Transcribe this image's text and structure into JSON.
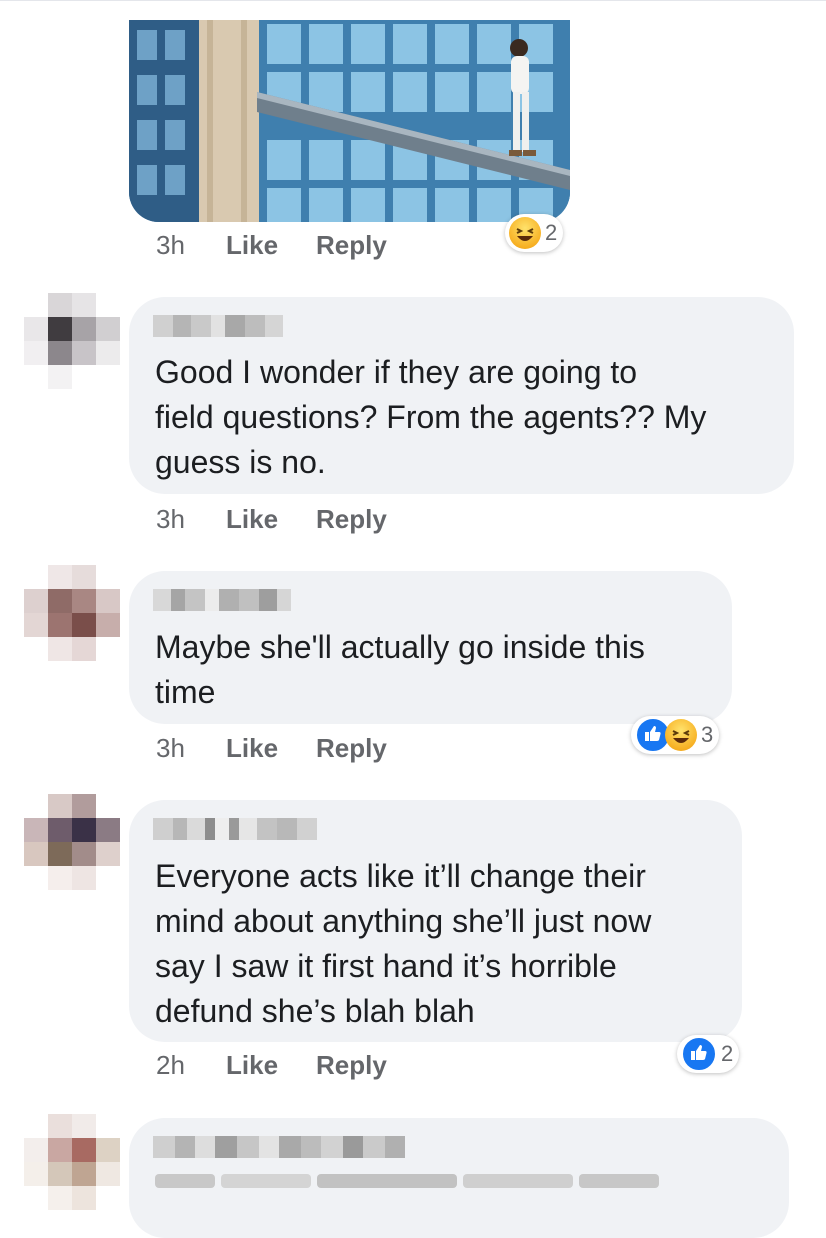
{
  "comment0": {
    "time": "3h",
    "like": "Like",
    "reply": "Reply",
    "reactions": {
      "icons": [
        "haha-icon"
      ],
      "count": "2"
    }
  },
  "comments": [
    {
      "text": "Good I wonder if they are going to\nfield questions? From the agents?? My\nguess is no.",
      "time": "3h",
      "like": "Like",
      "reply": "Reply"
    },
    {
      "text": "Maybe she'll actually go inside this\ntime",
      "time": "3h",
      "like": "Like",
      "reply": "Reply",
      "reactions": {
        "icons": [
          "like-icon",
          "haha-icon"
        ],
        "count": "3"
      }
    },
    {
      "text": "Everyone acts like it’ll change their\nmind about anything she’ll just now\nsay I saw it first hand it’s horrible\ndefund she’s blah blah",
      "time": "2h",
      "like": "Like",
      "reply": "Reply",
      "reactions": {
        "icons": [
          "like-icon"
        ],
        "count": "2"
      }
    },
    {
      "text": ""
    }
  ],
  "colors": {
    "bubble": "#f0f2f5",
    "meta_text": "#65676b",
    "like_blue": "#1877f2",
    "haha_yellow": "#f7b125"
  }
}
